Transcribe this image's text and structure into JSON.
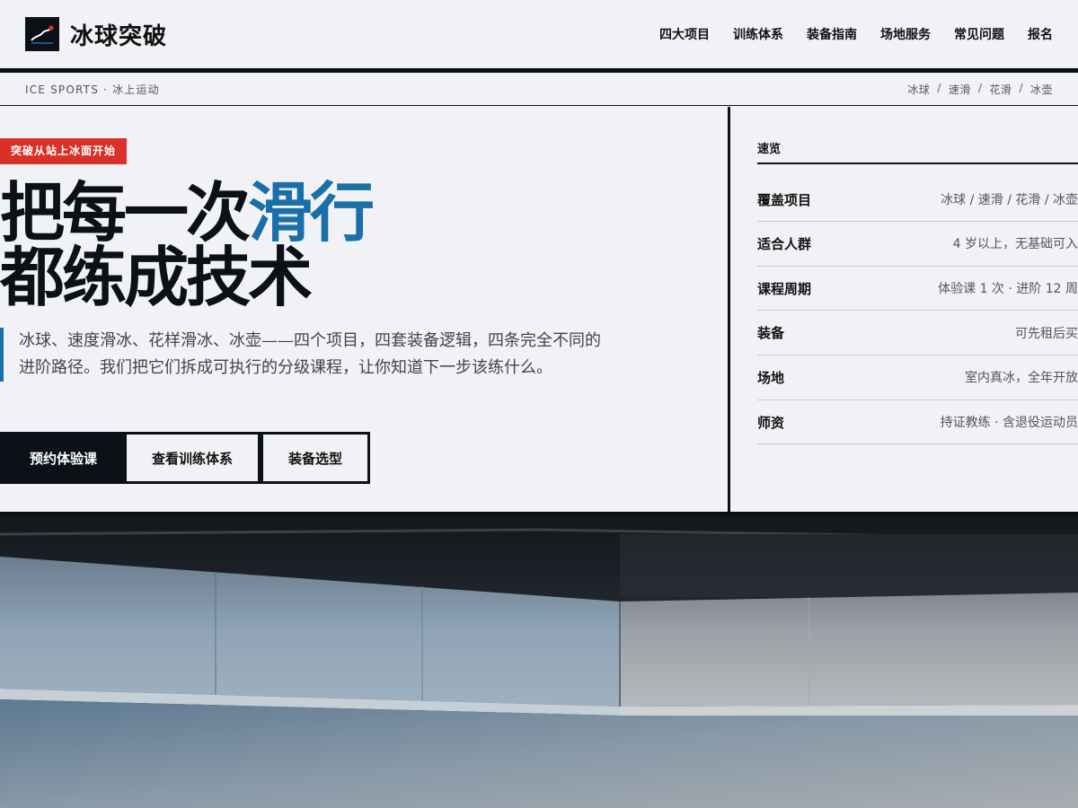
{
  "brand": {
    "name": "冰球突破"
  },
  "nav": {
    "items": [
      "四大项目",
      "训练体系",
      "装备指南",
      "场地服务",
      "常见问题",
      "报名"
    ]
  },
  "subbar": {
    "left": "ICE SPORTS · 冰上运动",
    "crumbs": [
      "冰球",
      "速滑",
      "花滑",
      "冰壶"
    ],
    "separator": "/"
  },
  "hero": {
    "tagline": "突破从站上冰面开始",
    "headline_part1": "把每一次",
    "headline_accent": "滑行",
    "headline_line2": "都练成技术",
    "lead": "冰球、速度滑冰、花样滑冰、冰壶——四个项目，四套装备逻辑，四条完全不同的进阶路径。我们把它们拆成可执行的分级课程，让你知道下一步该练什么。",
    "buttons": {
      "primary": "预约体验课",
      "secondary": "查看训练体系",
      "tertiary": "装备选型"
    }
  },
  "overview": {
    "title": "速览",
    "rows": [
      {
        "key": "覆盖项目",
        "value": "冰球 / 速滑 / 花滑 / 冰壶"
      },
      {
        "key": "适合人群",
        "value": "4 岁以上，无基础可入"
      },
      {
        "key": "课程周期",
        "value": "体验课 1 次 · 进阶 12 周"
      },
      {
        "key": "装备",
        "value": "可先租后买"
      },
      {
        "key": "场地",
        "value": "室内真冰，全年开放"
      },
      {
        "key": "师资",
        "value": "持证教练 · 含退役运动员"
      }
    ]
  },
  "colors": {
    "ink": "#0d1117",
    "accent_blue": "#1a6fa8",
    "tag_red": "#d9312a",
    "background": "#f0f2f5"
  },
  "icons": {
    "logo": "skate-trail-icon"
  }
}
